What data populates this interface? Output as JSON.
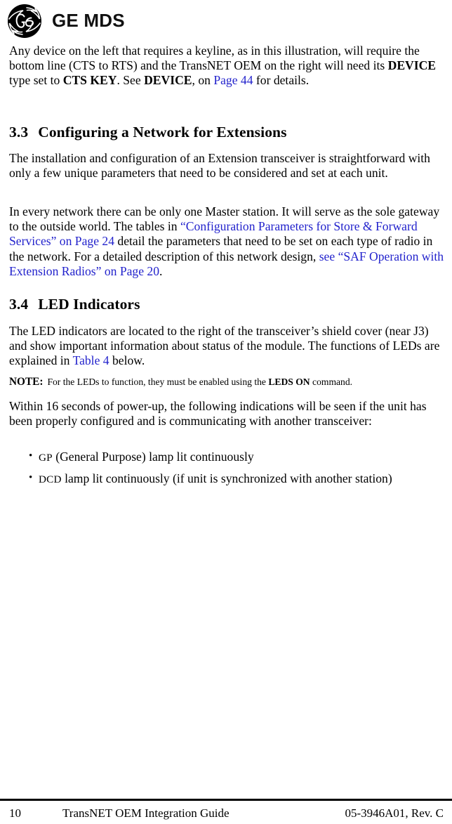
{
  "header": {
    "logo_icon": "ge-monogram-icon",
    "wordmark": "GE MDS"
  },
  "content": {
    "lead_paragraph": {
      "t1": "Any device on the left that requires a keyline, as in this illustration, will require the bottom line (CTS to RTS) and the TransNET OEM on the right will need its ",
      "b1": "DEVICE",
      "t2": " type set to ",
      "b2": "CTS KEY",
      "t3": ". See ",
      "b3": "DEVICE",
      "t4": ", on ",
      "link1": "Page 44",
      "t5": " for details."
    },
    "sections": [
      {
        "number": "3.3",
        "title": "Configuring a Network for Extensions",
        "paragraphs": {
          "p1": "The installation and configuration of an Extension transceiver is straightforward with only a few unique parameters that need to be considered and set at each unit.",
          "p2": {
            "t1": "In every network there can be only one Master station. It will serve as the sole gateway to the outside world. The tables in ",
            "link1": "“Configuration Parameters for Store & Forward Services” on Page 24",
            "t2": " detail the parameters that need to be set on each type of radio in the network. For a detailed description of this network design, ",
            "link2": "see “SAF Operation with Extension Radios” on Page 20",
            "t3": "."
          }
        }
      },
      {
        "number": "3.4",
        "title": "LED Indicators",
        "paragraphs": {
          "p1": {
            "t1": "The LED indicators are located to the right of the transceiver’s shield cover (near J3) and show important information about status of the module. The functions of LEDs are explained in ",
            "link1": "Table 4",
            "t2": " below."
          },
          "note": {
            "label": "NOTE:",
            "t1": "For the LEDs to function, they must be enabled using the ",
            "b1": "LEDS ON",
            "t2": " command."
          },
          "p2": "Within 16 seconds of power-up, the following indications will be seen if the unit has been properly configured and is communicating with another transceiver:"
        },
        "bullets": [
          {
            "small": "GP",
            "rest": " (General Purpose) lamp lit continuously"
          },
          {
            "small": "DCD",
            "rest": " lamp lit continuously (if unit is synchronized with another station)"
          }
        ]
      }
    ]
  },
  "footer": {
    "page_number": "10",
    "document_title": "TransNET OEM Integration Guide",
    "document_revision": "05-3946A01, Rev. C"
  },
  "colors": {
    "link": "#2222cc",
    "text": "#000000",
    "rule": "#000000"
  }
}
